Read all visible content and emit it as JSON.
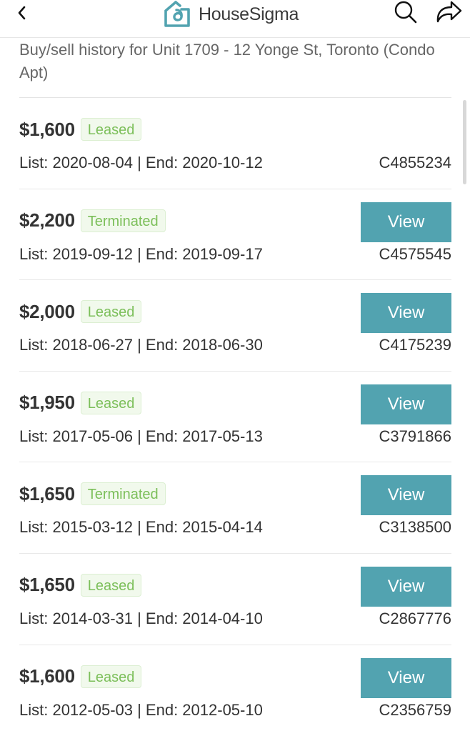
{
  "header": {
    "brand": "HouseSigma",
    "back_icon": "chevron-left-icon",
    "search_icon": "search-icon",
    "share_icon": "share-arrow-icon",
    "brand_color": "#52a3b0"
  },
  "subtitle": "Buy/sell history for Unit 1709 - 12 Yonge St, Toronto (Condo Apt)",
  "colors": {
    "view_button": "#52a3b0",
    "badge_text": "#7cbf5a",
    "badge_bg": "#f1f9ec"
  },
  "history": [
    {
      "price": "$1,600",
      "status": "Leased",
      "dates": "List: 2020-08-04 | End: 2020-10-12",
      "mls": "C4855234",
      "has_view": false
    },
    {
      "price": "$2,200",
      "status": "Terminated",
      "dates": "List: 2019-09-12 | End: 2019-09-17",
      "mls": "C4575545",
      "has_view": true,
      "view_label": "View"
    },
    {
      "price": "$2,000",
      "status": "Leased",
      "dates": "List: 2018-06-27 | End: 2018-06-30",
      "mls": "C4175239",
      "has_view": true,
      "view_label": "View"
    },
    {
      "price": "$1,950",
      "status": "Leased",
      "dates": "List: 2017-05-06 | End: 2017-05-13",
      "mls": "C3791866",
      "has_view": true,
      "view_label": "View"
    },
    {
      "price": "$1,650",
      "status": "Terminated",
      "dates": "List: 2015-03-12 | End: 2015-04-14",
      "mls": "C3138500",
      "has_view": true,
      "view_label": "View"
    },
    {
      "price": "$1,650",
      "status": "Leased",
      "dates": "List: 2014-03-31 | End: 2014-04-10",
      "mls": "C2867776",
      "has_view": true,
      "view_label": "View"
    },
    {
      "price": "$1,600",
      "status": "Leased",
      "dates": "List: 2012-05-03 | End: 2012-05-10",
      "mls": "C2356759",
      "has_view": true,
      "view_label": "View"
    }
  ]
}
